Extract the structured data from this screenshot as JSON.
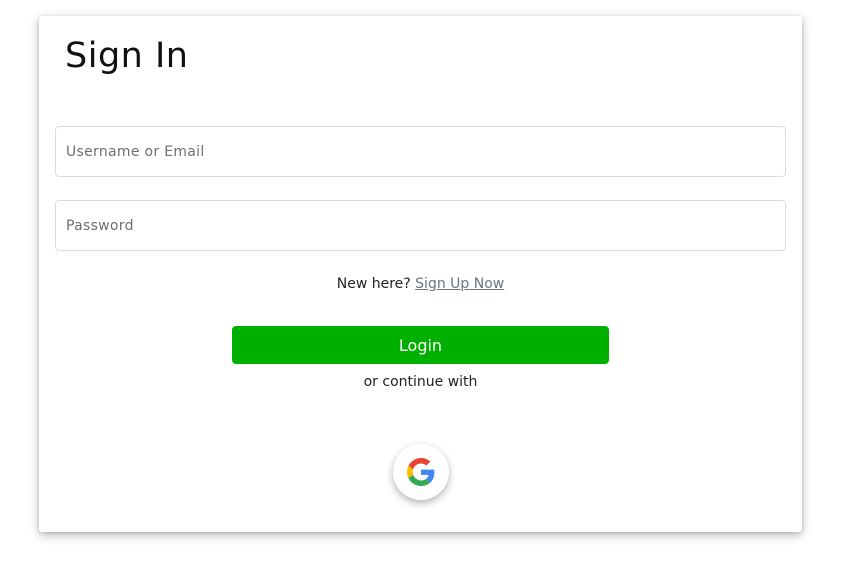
{
  "page": {
    "title": "Sign In"
  },
  "form": {
    "username_placeholder": "Username or Email",
    "password_placeholder": "Password",
    "signup_prompt": "New here?",
    "signup_link": "Sign Up Now",
    "login_label": "Login",
    "continue_text": "or continue with"
  },
  "social": {
    "google_icon": "google-logo-icon"
  },
  "colors": {
    "login_button": "#00b000",
    "link": "#6a7580",
    "text": "#222222"
  }
}
